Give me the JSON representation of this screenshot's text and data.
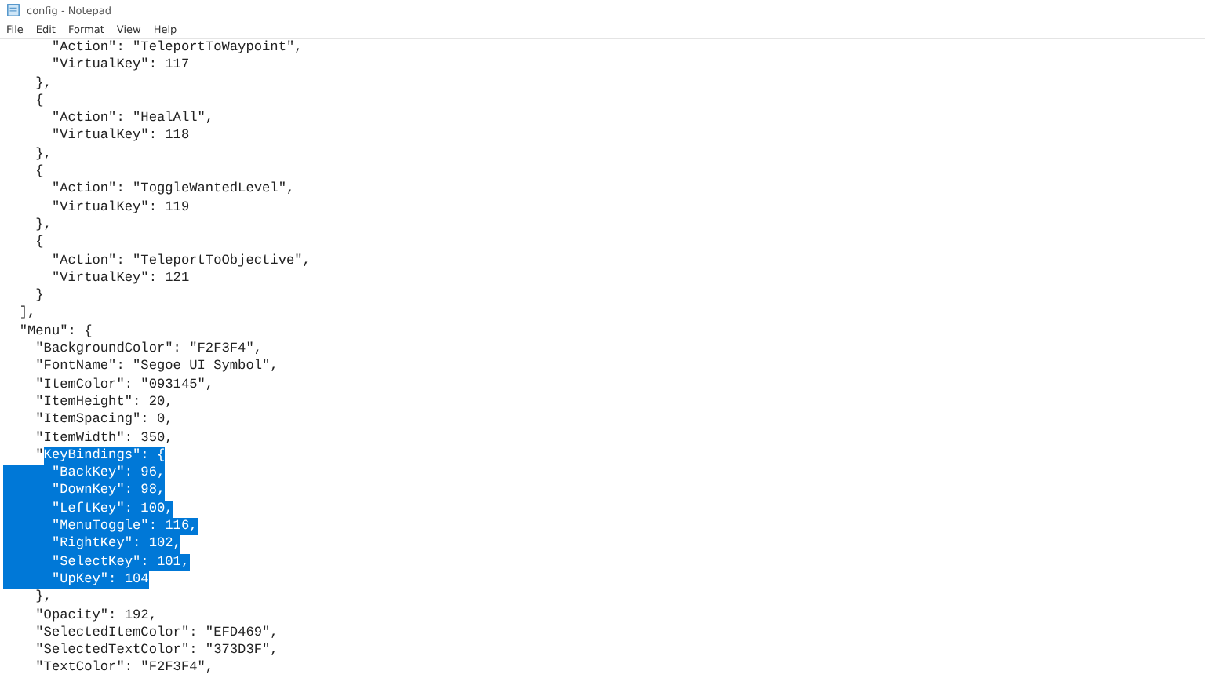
{
  "window": {
    "title": "config - Notepad"
  },
  "menu_bar": [
    {
      "label": "File"
    },
    {
      "label": "Edit"
    },
    {
      "label": "Format"
    },
    {
      "label": "View"
    },
    {
      "label": "Help"
    }
  ],
  "editor": {
    "lines": [
      {
        "segments": [
          {
            "text": "      \"Action\": \"TeleportToWaypoint\",",
            "selected": false
          }
        ]
      },
      {
        "segments": [
          {
            "text": "      \"VirtualKey\": 117",
            "selected": false
          }
        ]
      },
      {
        "segments": [
          {
            "text": "    },",
            "selected": false
          }
        ]
      },
      {
        "segments": [
          {
            "text": "    {",
            "selected": false
          }
        ]
      },
      {
        "segments": [
          {
            "text": "      \"Action\": \"HealAll\",",
            "selected": false
          }
        ]
      },
      {
        "segments": [
          {
            "text": "      \"VirtualKey\": 118",
            "selected": false
          }
        ]
      },
      {
        "segments": [
          {
            "text": "    },",
            "selected": false
          }
        ]
      },
      {
        "segments": [
          {
            "text": "    {",
            "selected": false
          }
        ]
      },
      {
        "segments": [
          {
            "text": "      \"Action\": \"ToggleWantedLevel\",",
            "selected": false
          }
        ]
      },
      {
        "segments": [
          {
            "text": "      \"VirtualKey\": 119",
            "selected": false
          }
        ]
      },
      {
        "segments": [
          {
            "text": "    },",
            "selected": false
          }
        ]
      },
      {
        "segments": [
          {
            "text": "    {",
            "selected": false
          }
        ]
      },
      {
        "segments": [
          {
            "text": "      \"Action\": \"TeleportToObjective\",",
            "selected": false
          }
        ]
      },
      {
        "segments": [
          {
            "text": "      \"VirtualKey\": 121",
            "selected": false
          }
        ]
      },
      {
        "segments": [
          {
            "text": "    }",
            "selected": false
          }
        ]
      },
      {
        "segments": [
          {
            "text": "  ],",
            "selected": false
          }
        ]
      },
      {
        "segments": [
          {
            "text": "  \"Menu\": {",
            "selected": false
          }
        ]
      },
      {
        "segments": [
          {
            "text": "    \"BackgroundColor\": \"F2F3F4\",",
            "selected": false
          }
        ]
      },
      {
        "segments": [
          {
            "text": "    \"FontName\": \"Segoe UI Symbol\",",
            "selected": false
          }
        ]
      },
      {
        "segments": [
          {
            "text": "    \"ItemColor\": \"093145\",",
            "selected": false
          }
        ]
      },
      {
        "segments": [
          {
            "text": "    \"ItemHeight\": 20,",
            "selected": false
          }
        ]
      },
      {
        "segments": [
          {
            "text": "    \"ItemSpacing\": 0,",
            "selected": false
          }
        ]
      },
      {
        "segments": [
          {
            "text": "    \"ItemWidth\": 350,",
            "selected": false
          }
        ]
      },
      {
        "segments": [
          {
            "text": "    \"",
            "selected": false
          },
          {
            "text": "KeyBindings\": {",
            "selected": true
          }
        ]
      },
      {
        "segments": [
          {
            "text": "      \"BackKey\": 96,",
            "selected": true
          }
        ]
      },
      {
        "segments": [
          {
            "text": "      \"DownKey\": 98,",
            "selected": true
          }
        ]
      },
      {
        "segments": [
          {
            "text": "      \"LeftKey\": 100,",
            "selected": true
          }
        ]
      },
      {
        "segments": [
          {
            "text": "      \"MenuToggle\": 116,",
            "selected": true
          }
        ]
      },
      {
        "segments": [
          {
            "text": "      \"RightKey\": 102,",
            "selected": true
          }
        ]
      },
      {
        "segments": [
          {
            "text": "      \"SelectKey\": 101,",
            "selected": true
          }
        ]
      },
      {
        "segments": [
          {
            "text": "      \"UpKey\": 104",
            "selected": true
          }
        ]
      },
      {
        "segments": [
          {
            "text": "    },",
            "selected": false
          }
        ]
      },
      {
        "segments": [
          {
            "text": "    \"Opacity\": 192,",
            "selected": false
          }
        ]
      },
      {
        "segments": [
          {
            "text": "    \"SelectedItemColor\": \"EFD469\",",
            "selected": false
          }
        ]
      },
      {
        "segments": [
          {
            "text": "    \"SelectedTextColor\": \"373D3F\",",
            "selected": false
          }
        ]
      },
      {
        "segments": [
          {
            "text": "    \"TextColor\": \"F2F3F4\",",
            "selected": false
          }
        ]
      }
    ]
  }
}
